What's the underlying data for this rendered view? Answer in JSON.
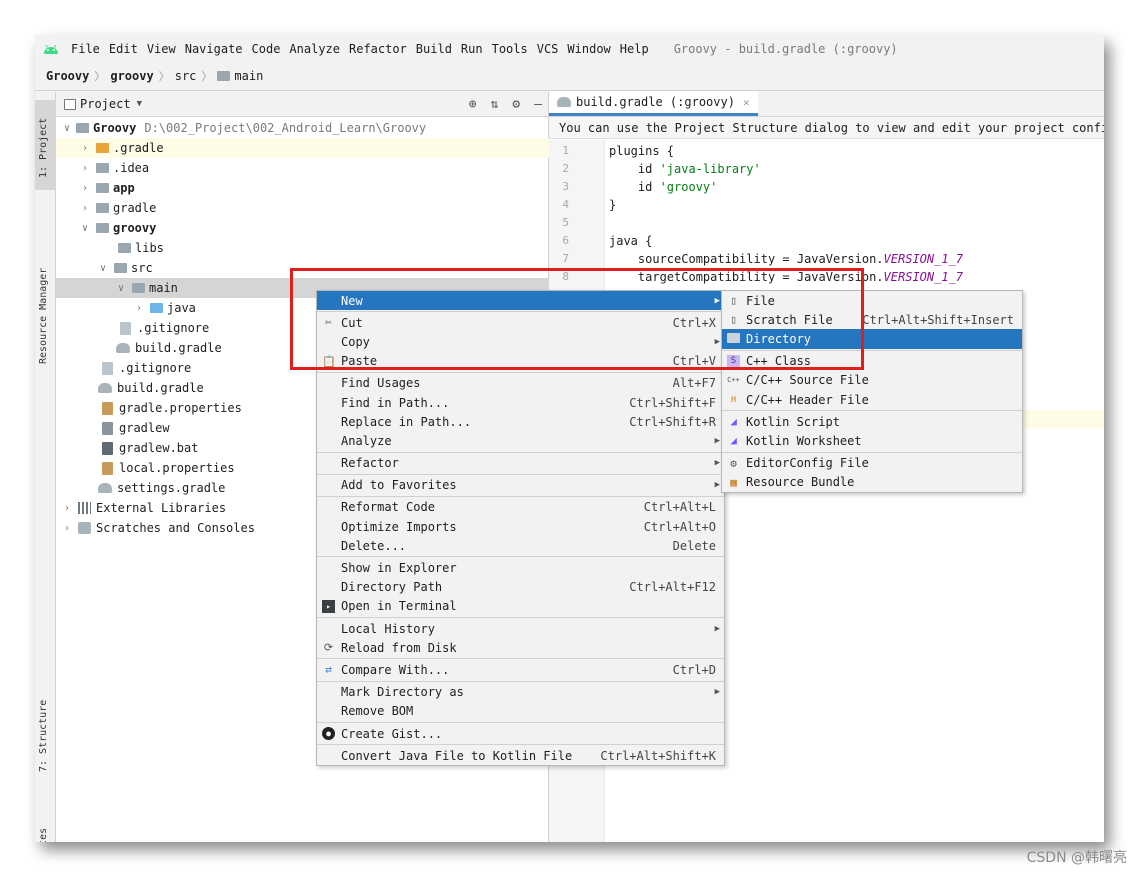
{
  "menubar": {
    "items": [
      "File",
      "Edit",
      "View",
      "Navigate",
      "Code",
      "Analyze",
      "Refactor",
      "Build",
      "Run",
      "Tools",
      "VCS",
      "Window",
      "Help"
    ],
    "window_title": "Groovy - build.gradle (:groovy)"
  },
  "breadcrumb": [
    "Groovy",
    "groovy",
    "src",
    "main"
  ],
  "toolstrip": {
    "project_tab": "1: Project",
    "resource_manager_tab": "Resource Manager",
    "structure_tab": "7: Structure",
    "favorites_tab": "Favorites"
  },
  "project_panel": {
    "title": "Project",
    "tree": [
      {
        "label": "Groovy",
        "path": "D:\\002_Project\\002_Android_Learn\\Groovy"
      },
      {
        "label": ".gradle"
      },
      {
        "label": ".idea"
      },
      {
        "label": "app"
      },
      {
        "label": "gradle"
      },
      {
        "label": "groovy"
      },
      {
        "label": "libs"
      },
      {
        "label": "src"
      },
      {
        "label": "main"
      },
      {
        "label": "java"
      },
      {
        "label": ".gitignore"
      },
      {
        "label": "build.gradle"
      },
      {
        "label": ".gitignore"
      },
      {
        "label": "build.gradle"
      },
      {
        "label": "gradle.properties"
      },
      {
        "label": "gradlew"
      },
      {
        "label": "gradlew.bat"
      },
      {
        "label": "local.properties"
      },
      {
        "label": "settings.gradle"
      },
      {
        "label": "External Libraries"
      },
      {
        "label": "Scratches and Consoles"
      }
    ]
  },
  "editor": {
    "tab_label": "build.gradle (:groovy)",
    "notice": "You can use the Project Structure dialog to view and edit your project configu",
    "line_numbers": [
      "1",
      "2",
      "3",
      "4",
      "5",
      "6",
      "7",
      "8"
    ],
    "lines": [
      [
        "plugins {",
        ""
      ],
      [
        "    id ",
        "'java-library'"
      ],
      [
        "    id ",
        "'groovy'"
      ],
      [
        "}",
        ""
      ],
      [
        "",
        ""
      ],
      [
        "java {",
        ""
      ],
      [
        "    sourceCompatibility = JavaVersion.",
        "VERSION_1_7"
      ],
      [
        "    targetCompatibility = JavaVersion.",
        "VERSION_1_7"
      ]
    ]
  },
  "context_menu": {
    "items": [
      {
        "label": "New",
        "shortcut": "",
        "submenu": true,
        "active": true
      },
      {
        "label": "Cut",
        "shortcut": "Ctrl+X",
        "icon": "scissors-icon"
      },
      {
        "label": "Copy",
        "shortcut": "",
        "submenu": true
      },
      {
        "label": "Paste",
        "shortcut": "Ctrl+V",
        "icon": "clipboard-icon"
      },
      {
        "label": "Find Usages",
        "shortcut": "Alt+F7"
      },
      {
        "label": "Find in Path...",
        "shortcut": "Ctrl+Shift+F"
      },
      {
        "label": "Replace in Path...",
        "shortcut": "Ctrl+Shift+R"
      },
      {
        "label": "Analyze",
        "shortcut": "",
        "submenu": true
      },
      {
        "label": "Refactor",
        "shortcut": "",
        "submenu": true
      },
      {
        "label": "Add to Favorites",
        "shortcut": "",
        "submenu": true
      },
      {
        "label": "Reformat Code",
        "shortcut": "Ctrl+Alt+L"
      },
      {
        "label": "Optimize Imports",
        "shortcut": "Ctrl+Alt+O"
      },
      {
        "label": "Delete...",
        "shortcut": "Delete"
      },
      {
        "label": "Show in Explorer",
        "shortcut": ""
      },
      {
        "label": "Directory Path",
        "shortcut": "Ctrl+Alt+F12"
      },
      {
        "label": "Open in Terminal",
        "shortcut": "",
        "icon": "terminal-icon"
      },
      {
        "label": "Local History",
        "shortcut": "",
        "submenu": true
      },
      {
        "label": "Reload from Disk",
        "shortcut": "",
        "icon": "reload-icon"
      },
      {
        "label": "Compare With...",
        "shortcut": "Ctrl+D",
        "icon": "compare-icon"
      },
      {
        "label": "Mark Directory as",
        "shortcut": "",
        "submenu": true
      },
      {
        "label": "Remove BOM",
        "shortcut": ""
      },
      {
        "label": "Create Gist...",
        "shortcut": "",
        "icon": "github-icon"
      },
      {
        "label": "Convert Java File to Kotlin File",
        "shortcut": "Ctrl+Alt+Shift+K"
      }
    ]
  },
  "submenu_new": {
    "items": [
      {
        "label": "File",
        "shortcut": ""
      },
      {
        "label": "Scratch File",
        "shortcut": "Ctrl+Alt+Shift+Insert"
      },
      {
        "label": "Directory",
        "shortcut": "",
        "active": true
      },
      {
        "label": "C++ Class",
        "shortcut": ""
      },
      {
        "label": "C/C++ Source File",
        "shortcut": ""
      },
      {
        "label": "C/C++ Header File",
        "shortcut": ""
      },
      {
        "label": "Kotlin Script",
        "shortcut": ""
      },
      {
        "label": "Kotlin Worksheet",
        "shortcut": ""
      },
      {
        "label": "EditorConfig File",
        "shortcut": ""
      },
      {
        "label": "Resource Bundle",
        "shortcut": ""
      }
    ]
  },
  "watermark": "CSDN @韩曙亮",
  "colors": {
    "selection": "#2675bf",
    "highlight_box": "#e01e1e",
    "string": "#067d17",
    "constant": "#871094"
  }
}
